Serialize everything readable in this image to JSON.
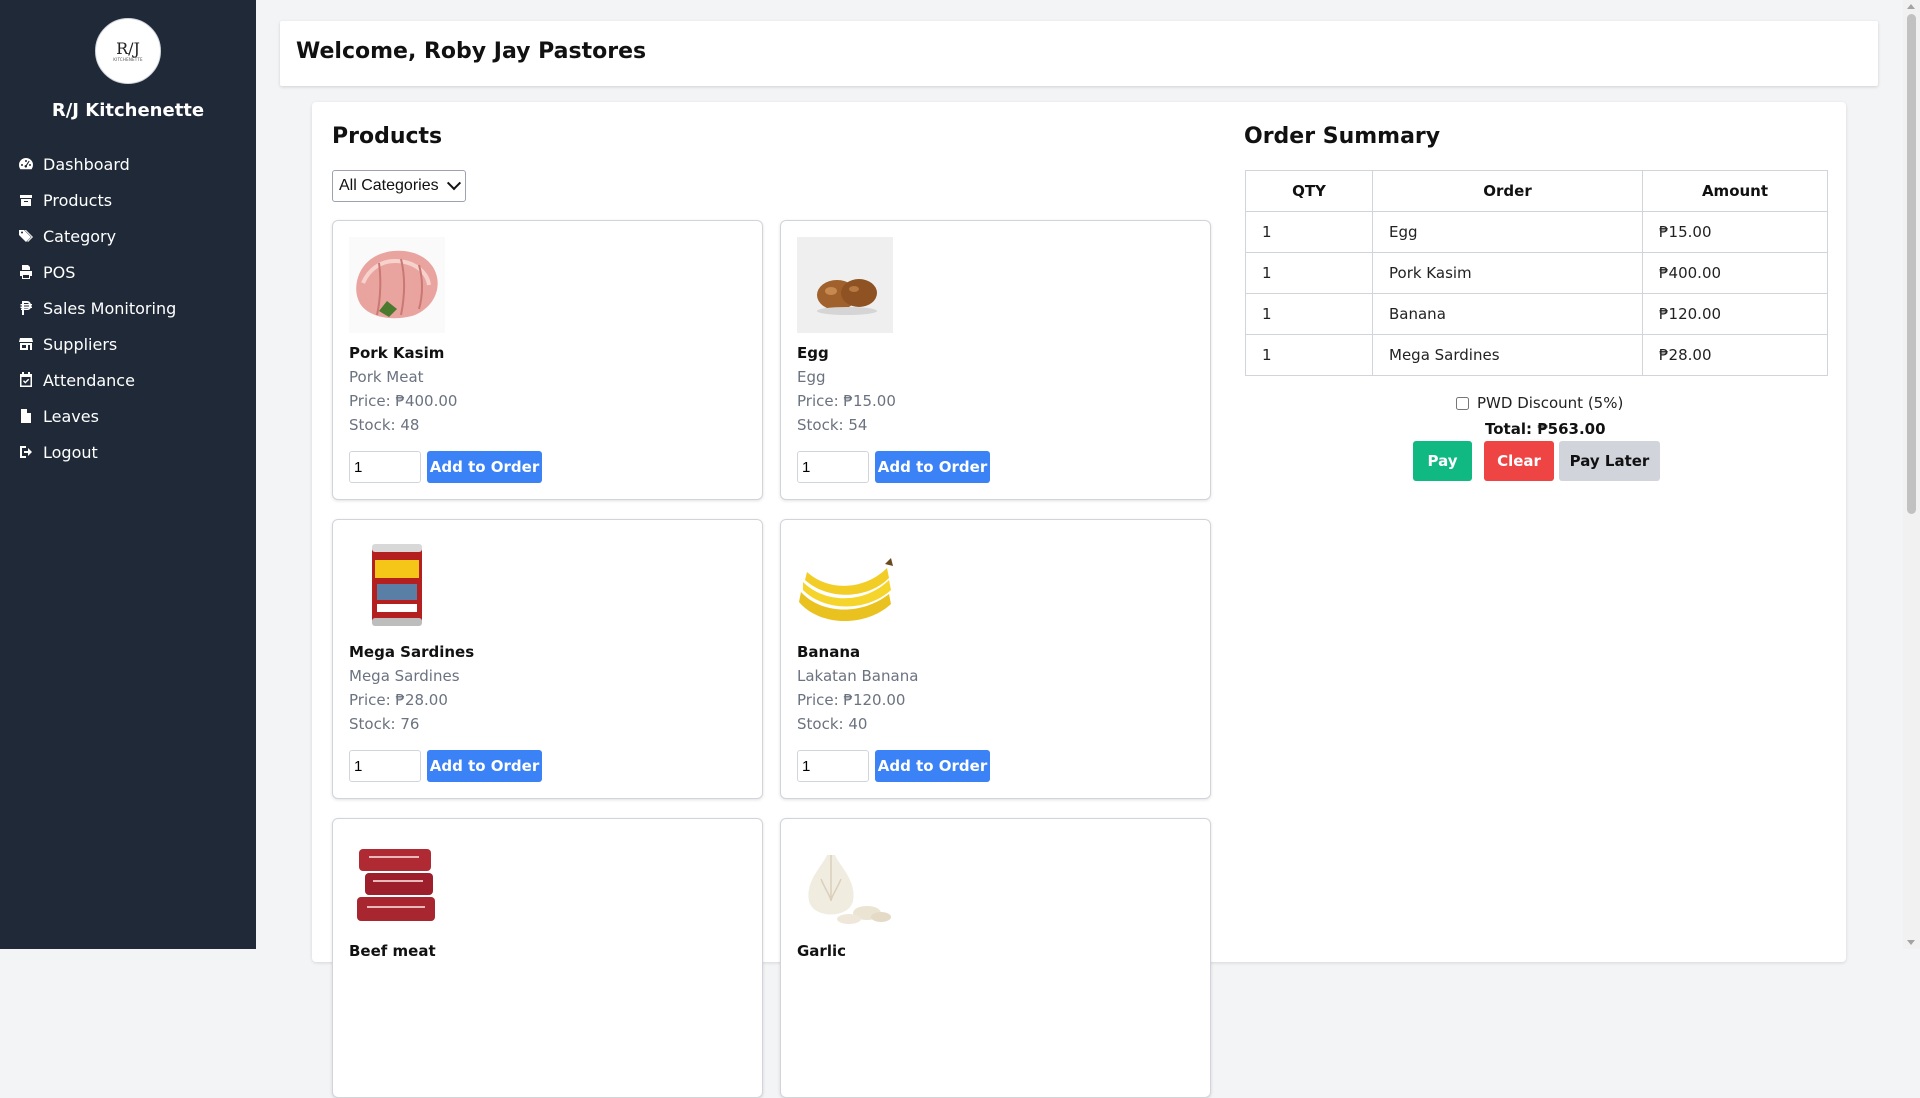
{
  "sidebar": {
    "brand": "R/J Kitchenette",
    "logo_monogram": "R/J",
    "logo_caption": "KITCHENETTE",
    "items": [
      {
        "label": "Dashboard",
        "icon": "dashboard-icon"
      },
      {
        "label": "Products",
        "icon": "box-icon"
      },
      {
        "label": "Category",
        "icon": "tags-icon"
      },
      {
        "label": "POS",
        "icon": "printer-icon"
      },
      {
        "label": "Sales Monitoring",
        "icon": "peso-icon"
      },
      {
        "label": "Suppliers",
        "icon": "store-icon"
      },
      {
        "label": "Attendance",
        "icon": "calendar-check-icon"
      },
      {
        "label": "Leaves",
        "icon": "file-icon"
      },
      {
        "label": "Logout",
        "icon": "logout-icon"
      }
    ]
  },
  "header": {
    "welcome": "Welcome, Roby Jay Pastores"
  },
  "products": {
    "title": "Products",
    "category_filter": "All Categories",
    "add_label": "Add to Order",
    "items": [
      {
        "name": "Pork Kasim",
        "description": "Pork Meat",
        "price": "Price: ₱400.00",
        "stock": "Stock: 48",
        "qty": "1"
      },
      {
        "name": "Egg",
        "description": "Egg",
        "price": "Price: ₱15.00",
        "stock": "Stock: 54",
        "qty": "1"
      },
      {
        "name": "Mega Sardines",
        "description": "Mega Sardines",
        "price": "Price: ₱28.00",
        "stock": "Stock: 76",
        "qty": "1"
      },
      {
        "name": "Banana",
        "description": "Lakatan Banana",
        "price": "Price: ₱120.00",
        "stock": "Stock: 40",
        "qty": "1"
      },
      {
        "name": "Beef meat",
        "description": "",
        "price": "",
        "stock": "",
        "qty": ""
      },
      {
        "name": "Garlic",
        "description": "",
        "price": "",
        "stock": "",
        "qty": ""
      }
    ]
  },
  "order": {
    "title": "Order Summary",
    "columns": [
      "QTY",
      "Order",
      "Amount"
    ],
    "rows": [
      [
        "1",
        "Egg",
        "₱15.00"
      ],
      [
        "1",
        "Pork Kasim",
        "₱400.00"
      ],
      [
        "1",
        "Banana",
        "₱120.00"
      ],
      [
        "1",
        "Mega Sardines",
        "₱28.00"
      ]
    ],
    "discount_label": "PWD Discount (5%)",
    "discount_checked": false,
    "total": "Total: ₱563.00",
    "pay_label": "Pay",
    "clear_label": "Clear",
    "pay_later_label": "Pay Later"
  },
  "colors": {
    "sidebar_bg": "#1f2937",
    "primary": "#3b82f6",
    "pay": "#10b981",
    "clear": "#ef4444",
    "pay_later": "#d1d5db"
  }
}
